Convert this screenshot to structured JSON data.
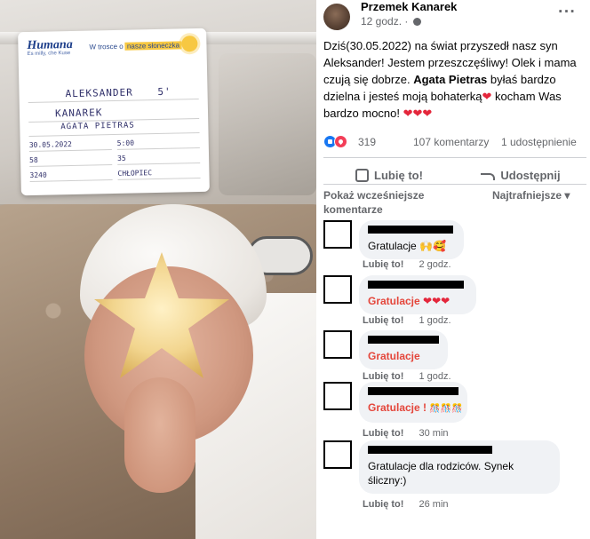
{
  "photo": {
    "card": {
      "brand": "Humana",
      "brand_sub": "Es milly, che Kuse",
      "tagline_prefix": "W trosce o",
      "tagline_highlight": "nasze słoneczka",
      "first_name": "ALEKSANDER",
      "first_name_extra": "5'",
      "last_name": "KANAREK",
      "mother": "AGATA PIETRAS",
      "date": "30.05.2022",
      "time": "5:00",
      "num1": "58",
      "num2": "35",
      "weight": "3240",
      "sex": "CHŁOPIEC"
    }
  },
  "post": {
    "author": "Przemek Kanarek",
    "time": "12 godz. ·",
    "more": "···",
    "text_1": "Dziś(30.05.2022) na świat przyszedł nasz syn Aleksander! Jestem przeszczęśliwy! Olek i mama czują się dobrze.",
    "text_tag": "Agata Pietras",
    "text_2": "byłaś bardzo dzielna i jesteś moją bohaterką",
    "text_heart": "❤",
    "text_3": "kocham Was bardzo mocno!",
    "text_end_hearts": "❤❤❤",
    "reactions_count": "319",
    "comments_count": "107 komentarzy",
    "shares_count": "1 udostępnienie",
    "like_label": "Lubię to!",
    "share_label": "Udostępnij",
    "previous_comments": "Pokaż wcześniejsze komentarze",
    "sort_label": "Najtrafniejsze ▾"
  },
  "comments": [
    {
      "text": "Gratulacje",
      "emoji": "🙌🥰",
      "like": "Lubię to!",
      "time": "2 godz."
    },
    {
      "text": "Gratulacje",
      "emoji": "❤❤❤",
      "like": "Lubię to!",
      "time": "1 godz."
    },
    {
      "text": "Gratulacje",
      "emoji": "",
      "like": "Lubię to!",
      "time": "1 godz."
    },
    {
      "text": "Gratulacje !",
      "emoji": "🎊🎊🎊",
      "like": "Lubię to!",
      "time": "30 min"
    },
    {
      "text_1": "Gratulacje dla rodziców. Synek",
      "text_2": "śliczny:)",
      "like": "Lubię to!",
      "time": "26 min"
    }
  ],
  "colors": {
    "link_blue": "#1877f2",
    "meta_gray": "#65676b",
    "bubble_bg": "#f0f2f5",
    "heart_red": "#e4263b",
    "comment_red": "#e4463b"
  }
}
